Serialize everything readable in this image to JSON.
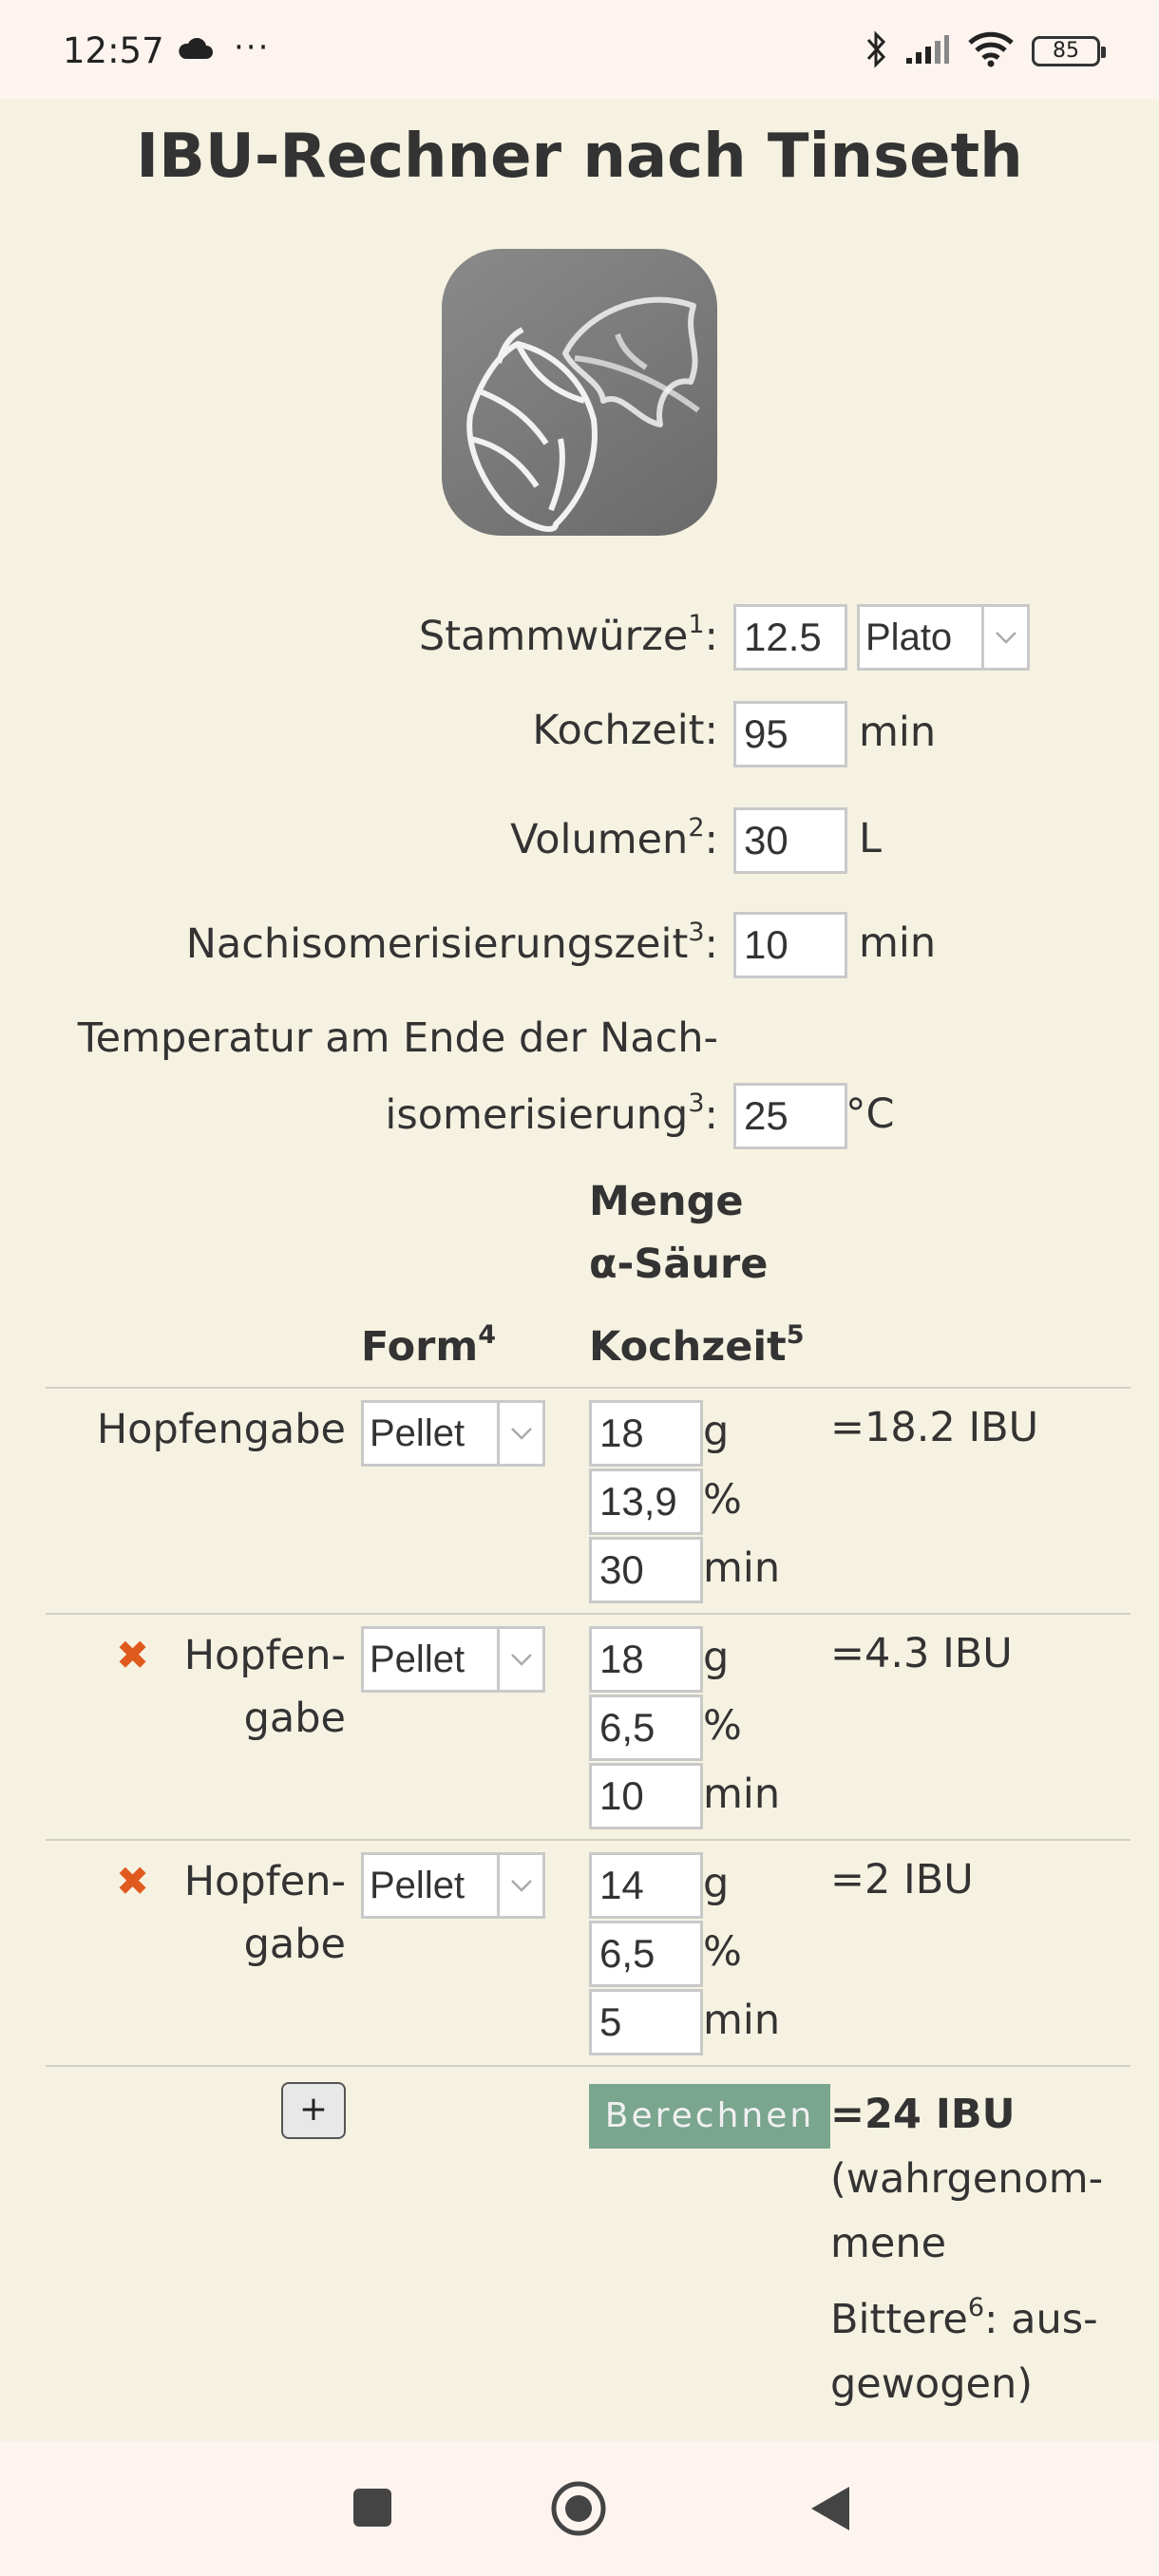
{
  "status_bar": {
    "time": "12:57",
    "more": "···",
    "battery": "85"
  },
  "page": {
    "title": "IBU-Rechner nach Tinseth"
  },
  "logo": {
    "icon": "hop-icon"
  },
  "form": {
    "stammwuerze": {
      "label": "Stammwürze",
      "footnote": "1",
      "value": "12.5",
      "unit_select": "Plato"
    },
    "kochzeit": {
      "label": "Kochzeit:",
      "value": "95",
      "unit": "min"
    },
    "volumen": {
      "label": "Volumen",
      "footnote": "2",
      "value": "30",
      "unit": "L"
    },
    "nachiso_zeit": {
      "label": "Nachisomerisierungszeit",
      "footnote": "3",
      "value": "10",
      "unit": "min"
    },
    "temperatur": {
      "label_line1": "Temperatur am Ende der Nach-",
      "label_line2": "isomerisierung",
      "footnote": "3",
      "value": "25",
      "unit": "°C"
    }
  },
  "table": {
    "col_form": "Form",
    "col_form_footnote": "4",
    "col_menge": "Menge",
    "col_alpha": "α-Säure",
    "col_kochzeit": "Kochzeit",
    "col_kochzeit_footnote": "5",
    "rows": [
      {
        "label": "Hopfengabe",
        "form": "Pellet",
        "menge": "18",
        "menge_unit": "g",
        "alpha": "13,9",
        "alpha_unit": "%",
        "zeit": "30",
        "zeit_unit": "min",
        "ibu": "=18.2 IBU"
      },
      {
        "label_line1": "Hopfen-",
        "label_line2": "gabe",
        "remove": "✖",
        "form": "Pellet",
        "menge": "18",
        "menge_unit": "g",
        "alpha": "6,5",
        "alpha_unit": "%",
        "zeit": "10",
        "zeit_unit": "min",
        "ibu": "=4.3 IBU"
      },
      {
        "label_line1": "Hopfen-",
        "label_line2": "gabe",
        "remove": "✖",
        "form": "Pellet",
        "menge": "14",
        "menge_unit": "g",
        "alpha": "6,5",
        "alpha_unit": "%",
        "zeit": "5",
        "zeit_unit": "min",
        "ibu": "=2 IBU"
      }
    ]
  },
  "actions": {
    "add": "+",
    "calculate": "Berechnen"
  },
  "result": {
    "total": "=24 IBU",
    "line1": "(wahrgenom-",
    "line2": "mene",
    "line3": "Bittere",
    "line3_footnote": "6",
    "line3_rest": ": aus-",
    "line4": "gewogen)"
  }
}
